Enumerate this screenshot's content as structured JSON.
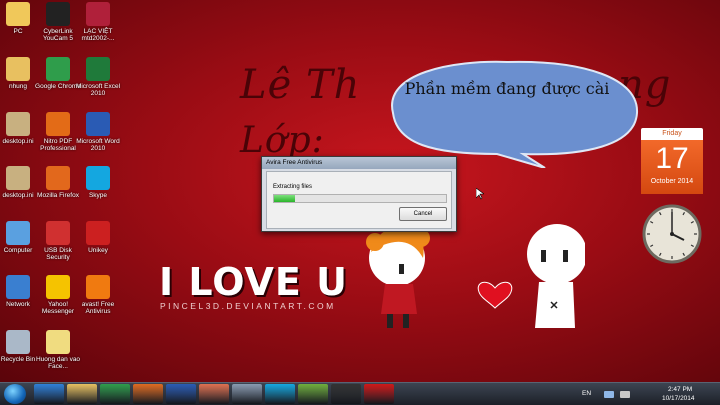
{
  "desktop_icons": [
    {
      "label": "PC",
      "icon": "computer-icon",
      "color": "#f0c85a"
    },
    {
      "label": "CyberLink YouCam 5",
      "icon": "webcam-icon",
      "color": "#222222"
    },
    {
      "label": "LẠC VIỆT mtd2002-...",
      "icon": "dictionary-icon",
      "color": "#b0203a"
    },
    {
      "label": "nhung",
      "icon": "folder-icon",
      "color": "#e8c060"
    },
    {
      "label": "Google Chrome",
      "icon": "chrome-icon",
      "color": "#2f9d4b"
    },
    {
      "label": "Microsoft Excel 2010",
      "icon": "excel-icon",
      "color": "#1f7a3a"
    },
    {
      "label": "desktop.ini",
      "icon": "settings-file-icon",
      "color": "#c8b080"
    },
    {
      "label": "Nitro PDF Professional",
      "icon": "nitro-pdf-icon",
      "color": "#e36b17"
    },
    {
      "label": "Microsoft Word 2010",
      "icon": "word-icon",
      "color": "#2a5bb4"
    },
    {
      "label": "desktop.ini",
      "icon": "settings-file-icon",
      "color": "#c8b080"
    },
    {
      "label": "Mozilla Firefox",
      "icon": "firefox-icon",
      "color": "#e2681c"
    },
    {
      "label": "Skype",
      "icon": "skype-icon",
      "color": "#14a7e0"
    },
    {
      "label": "Computer",
      "icon": "monitor-icon",
      "color": "#5aa0e0"
    },
    {
      "label": "USB Disk Security",
      "icon": "shield-icon",
      "color": "#d03030"
    },
    {
      "label": "Unikey",
      "icon": "unikey-icon",
      "color": "#cc2020"
    },
    {
      "label": "Network",
      "icon": "network-globe-icon",
      "color": "#3a7fd0"
    },
    {
      "label": "Yahoo! Messenger",
      "icon": "yahoo-messenger-icon",
      "color": "#f5c300"
    },
    {
      "label": "avast! Free Antivirus",
      "icon": "avast-icon",
      "color": "#f07a10"
    },
    {
      "label": "Recycle Bin",
      "icon": "recycle-bin-icon",
      "color": "#aab8c8"
    },
    {
      "label": "Huong dan vao Face...",
      "icon": "document-icon",
      "color": "#f0dc80"
    }
  ],
  "wallpaper": {
    "line1": "Lê Th",
    "line1_tail": "ng",
    "line2": "Lớp: ",
    "love_text": "I LOVE U",
    "signature": "PINCEL3D.DEVIANTART.COM"
  },
  "speech_bubble": {
    "text": "Phần mềm đang được cài",
    "fill": "#6b8fcf"
  },
  "install_dialog": {
    "title": "Avira Free Antivirus",
    "status": "Extracting files",
    "progress_fraction": 0.12,
    "cancel_label": "Cancel"
  },
  "calendar_gadget": {
    "weekday": "Friday",
    "day": "17",
    "month_year": "October 2014"
  },
  "taskbar": {
    "pinned": [
      {
        "icon": "internet-explorer-icon",
        "color": "#2f7fd8"
      },
      {
        "icon": "file-explorer-icon",
        "color": "#e8c060"
      },
      {
        "icon": "chrome-icon",
        "color": "#2f9d4b"
      },
      {
        "icon": "media-player-icon",
        "color": "#e06a20"
      },
      {
        "icon": "word-icon",
        "color": "#2a5bb4"
      },
      {
        "icon": "paint-icon",
        "color": "#e07050"
      },
      {
        "icon": "settings-icon",
        "color": "#8a9ab0"
      },
      {
        "icon": "skype-icon",
        "color": "#14a7e0"
      },
      {
        "icon": "paint-icon",
        "color": "#6fae3c"
      },
      {
        "icon": "video-icon",
        "color": "#333333"
      },
      {
        "icon": "avira-icon",
        "color": "#d01818"
      }
    ],
    "language": "EN",
    "time": "2:47 PM",
    "date": "10/17/2014"
  }
}
